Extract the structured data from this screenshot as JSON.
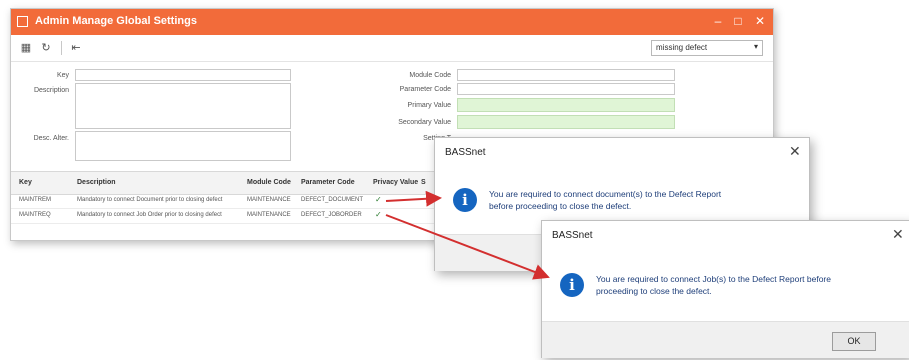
{
  "window": {
    "title": "Admin Manage Global Settings",
    "minimize_glyph": "–",
    "maximize_glyph": "□",
    "close_glyph": "✕"
  },
  "toolbar": {
    "filter_value": "missing defect",
    "filter_arrow": "▾"
  },
  "form": {
    "key_label": "Key",
    "description_label": "Description",
    "desc_alter_label": "Desc. Alter.",
    "module_code_label": "Module Code",
    "parameter_code_label": "Parameter Code",
    "primary_value_label": "Primary Value",
    "secondary_value_label": "Secondary Value",
    "setting_label": "Setting T"
  },
  "grid": {
    "headers": [
      "Key",
      "Description",
      "Module Code",
      "Parameter Code",
      "Privacy Value",
      "S"
    ],
    "rows": [
      {
        "key": "MAINTREM",
        "description": "Mandatory to connect Document prior to closing defect",
        "module_code": "MAINTENANCE",
        "parameter_code": "DEFECT_DOCUMENT",
        "check": "✓"
      },
      {
        "key": "MAINTREQ",
        "description": "Mandatory to connect Job Order prior to closing defect",
        "module_code": "MAINTENANCE",
        "parameter_code": "DEFECT_JOBORDER",
        "check": "✓"
      }
    ]
  },
  "dialog1": {
    "title": "BASSnet",
    "close_glyph": "✕",
    "icon_glyph": "i",
    "message_line1": "You are required to connect document(s) to the Defect Report",
    "message_line2": "before proceeding to close the defect."
  },
  "dialog2": {
    "title": "BASSnet",
    "close_glyph": "✕",
    "icon_glyph": "i",
    "message_line1": "You are required to connect Job(s) to the Defect Report before",
    "message_line2": "proceeding to close the defect.",
    "ok_label": "OK"
  },
  "colors": {
    "titlebar": "#f26b3a",
    "green_field": "#e0f5d6",
    "arrow": "#d32f2f",
    "info_icon": "#1565c0"
  }
}
